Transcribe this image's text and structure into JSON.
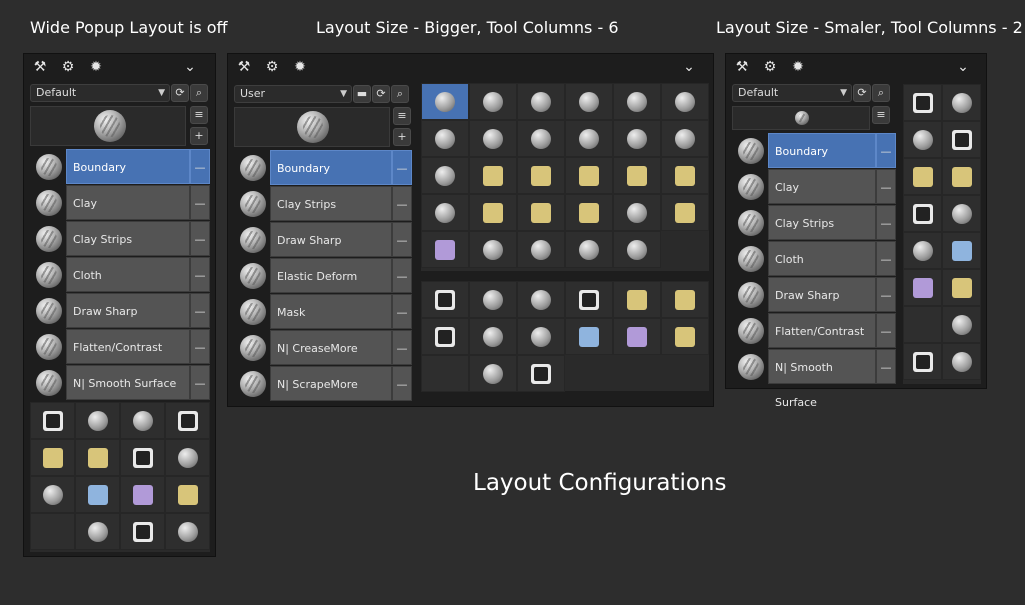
{
  "titles": {
    "left": "Wide Popup Layout is off",
    "middle": "Layout Size - Bigger, Tool Columns - 6",
    "right": "Layout Size - Smaler, Tool Columns - 2",
    "center": "Layout Configurations"
  },
  "header_icons": [
    "tool-settings-icon",
    "brush-settings-icon",
    "gear-icon",
    "chevron-down-icon"
  ],
  "left_panel": {
    "preset": "Default",
    "brushes": [
      {
        "label": "Boundary",
        "selected": true
      },
      {
        "label": "Clay",
        "selected": false
      },
      {
        "label": "Clay Strips",
        "selected": false
      },
      {
        "label": "Cloth",
        "selected": false
      },
      {
        "label": "Draw Sharp",
        "selected": false
      },
      {
        "label": "Flatten/Contrast",
        "selected": false
      },
      {
        "label": "N| Smooth Surface",
        "selected": false
      }
    ],
    "remove_label": "—"
  },
  "middle_panel": {
    "preset": "User",
    "brushes": [
      {
        "label": "Boundary",
        "selected": true
      },
      {
        "label": "Clay Strips",
        "selected": false
      },
      {
        "label": "Draw Sharp",
        "selected": false
      },
      {
        "label": "Elastic Deform",
        "selected": false
      },
      {
        "label": "Mask",
        "selected": false
      },
      {
        "label": "N| CreaseMore",
        "selected": false
      },
      {
        "label": "N| ScrapeMore",
        "selected": false
      }
    ],
    "remove_label": "—"
  },
  "right_panel": {
    "preset": "Default",
    "brushes": [
      {
        "label": "Boundary",
        "selected": true
      },
      {
        "label": "Clay",
        "selected": false
      },
      {
        "label": "Clay Strips",
        "selected": false
      },
      {
        "label": "Cloth",
        "selected": false
      },
      {
        "label": "Draw Sharp",
        "selected": false
      },
      {
        "label": "Flatten/Contrast",
        "selected": false
      },
      {
        "label": "N| Smooth Surface",
        "selected": false
      }
    ],
    "remove_label": "—"
  },
  "icons": {
    "plus": "+",
    "chevron": "⌄",
    "refresh": "⟳",
    "search": "⌕",
    "folder": "▬",
    "list_add": "≡"
  }
}
